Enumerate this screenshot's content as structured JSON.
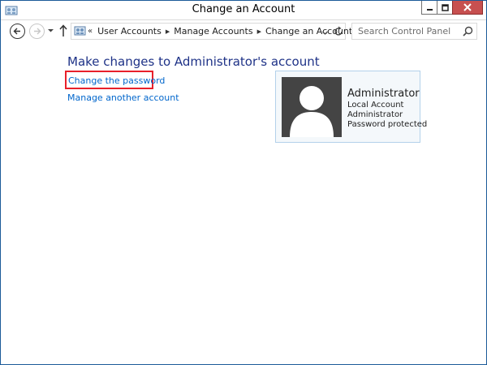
{
  "window": {
    "title": "Change an Account"
  },
  "navigation": {
    "breadcrumb": {
      "overflow": "«",
      "items": [
        "User Accounts",
        "Manage Accounts",
        "Change an Account"
      ]
    },
    "search": {
      "placeholder": "Search Control Panel"
    }
  },
  "main": {
    "heading": "Make changes to Administrator's account",
    "links": [
      {
        "label": "Change the password",
        "highlighted": true
      },
      {
        "label": "Manage another account"
      }
    ]
  },
  "account": {
    "name": "Administrator",
    "details": [
      "Local Account",
      "Administrator",
      "Password protected"
    ]
  },
  "colors": {
    "heading": "#1e3287",
    "link": "#0066cc",
    "highlight_box": "#e8202a",
    "close_button": "#c75050",
    "card_background": "#f4f8fb",
    "avatar_background": "#444444"
  }
}
